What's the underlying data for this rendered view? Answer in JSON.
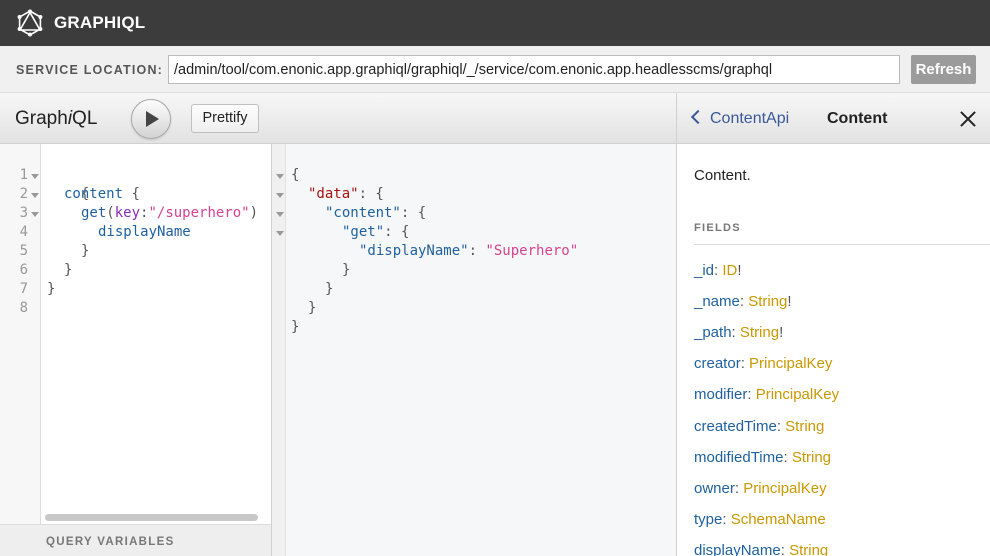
{
  "topbar": {
    "app_title": "GRAPHIQL",
    "logo_icon": "graphql-logo-icon"
  },
  "service": {
    "label": "SERVICE LOCATION:",
    "url": "/admin/tool/com.enonic.app.graphiql/graphiql/_/service/com.enonic.app.headlesscms/graphql",
    "refresh_label": "Refresh"
  },
  "toolbar": {
    "brand_prefix": "Graph",
    "brand_italic": "i",
    "brand_suffix": "QL",
    "prettify_label": "Prettify",
    "run_icon": "play-icon"
  },
  "query": {
    "line_numbers": [
      "1",
      "2",
      "3",
      "4",
      "5",
      "6",
      "7",
      "8"
    ],
    "tokens": {
      "l1_open": "{",
      "l2_field": "content",
      "l2_brace": " {",
      "l3_field": "get",
      "l3_paren": "(",
      "l3_arg": "key",
      "l3_colon": ":",
      "l3_value": "\"/superhero\"",
      "l3_close": ")",
      "l4_field": "displayName",
      "l5_close": "}",
      "l6_close": "}",
      "l7_close": "}"
    },
    "variables_label": "QUERY VARIABLES"
  },
  "result": {
    "tokens": {
      "r1": "{",
      "r2_key": "\"data\"",
      "r2_rest": ": {",
      "r3_key": "\"content\"",
      "r3_rest": ": {",
      "r4_key": "\"get\"",
      "r4_rest": ": {",
      "r5_key": "\"displayName\"",
      "r5_colon": ": ",
      "r5_value": "\"Superhero\"",
      "r6": "}",
      "r7": "}",
      "r8": "}",
      "r9": "}"
    }
  },
  "docs": {
    "back_label": "ContentApi",
    "title": "Content",
    "description": "Content.",
    "fields_heading": "FIELDS",
    "fields": [
      {
        "name": "_id",
        "type": "ID",
        "non_null": "!"
      },
      {
        "name": "_name",
        "type": "String",
        "non_null": "!"
      },
      {
        "name": "_path",
        "type": "String",
        "non_null": "!"
      },
      {
        "name": "creator",
        "type": "PrincipalKey",
        "non_null": ""
      },
      {
        "name": "modifier",
        "type": "PrincipalKey",
        "non_null": ""
      },
      {
        "name": "createdTime",
        "type": "String",
        "non_null": ""
      },
      {
        "name": "modifiedTime",
        "type": "String",
        "non_null": ""
      },
      {
        "name": "owner",
        "type": "PrincipalKey",
        "non_null": ""
      },
      {
        "name": "type",
        "type": "SchemaName",
        "non_null": ""
      },
      {
        "name": "displayName",
        "type": "String",
        "non_null": ""
      }
    ]
  }
}
